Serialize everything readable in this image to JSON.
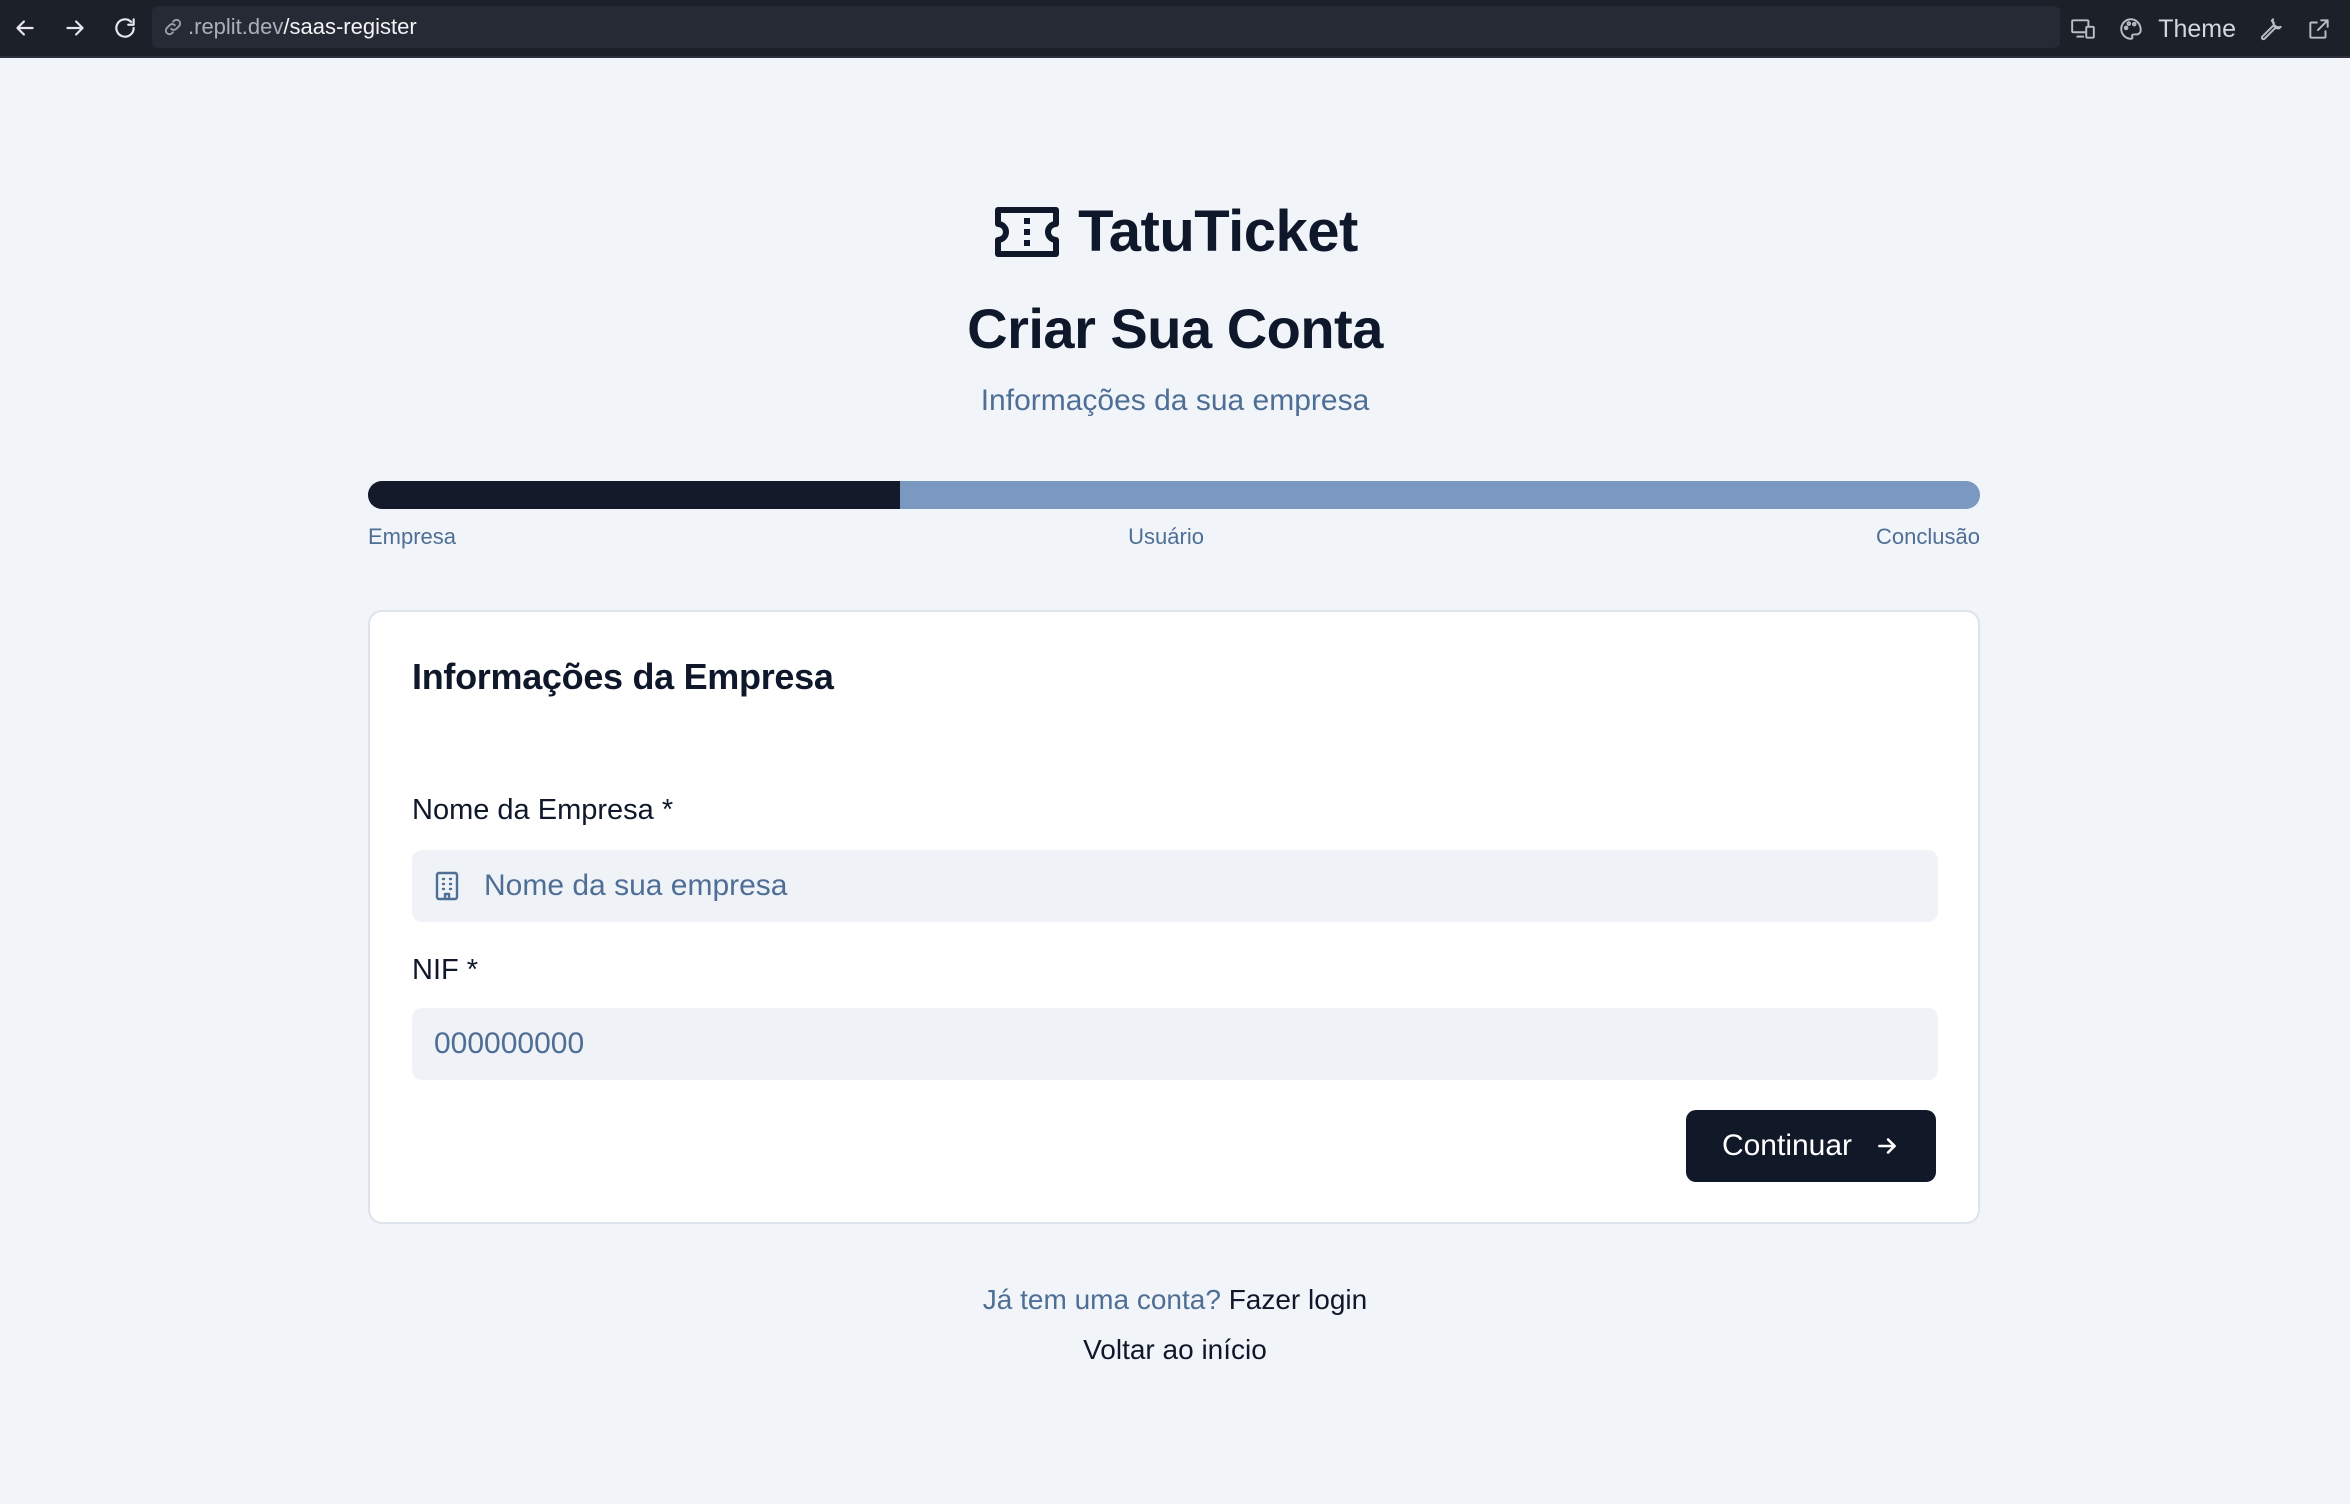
{
  "browser": {
    "url_host": ".replit.dev",
    "url_path": "/saas-register",
    "theme_label": "Theme"
  },
  "brand": {
    "name": "TatuTicket"
  },
  "page": {
    "title": "Criar Sua Conta",
    "subtitle": "Informações da sua empresa"
  },
  "progress": {
    "value": 0.33,
    "steps": [
      "Empresa",
      "Usuário",
      "Conclusão"
    ]
  },
  "form": {
    "title": "Informações da Empresa",
    "company_name_label": "Nome da Empresa *",
    "company_name_placeholder": "Nome da sua empresa",
    "company_name_value": "",
    "nif_label": "NIF *",
    "nif_placeholder": "000000000",
    "nif_value": "",
    "continue_label": "Continuar"
  },
  "footer": {
    "have_account": "Já tem uma conta?",
    "login_link": "Fazer login",
    "back_link": "Voltar ao início"
  },
  "colors": {
    "primary": "#111827",
    "progress_track": "#7a98c0",
    "muted_text": "#4f6e96",
    "background": "#f1f5f9"
  }
}
